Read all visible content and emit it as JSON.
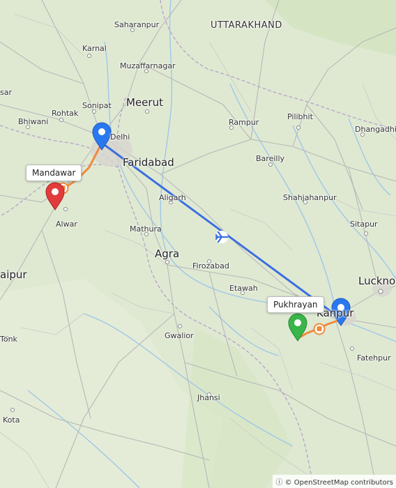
{
  "map": {
    "places": {
      "saharanpur": "Saharanpur",
      "uttarakhand": "UTTARAKHAND",
      "karnal": "Karnal",
      "muzaffarnagar": "Muzaffarnagar",
      "sar": "sar",
      "sonipat": "Sonipat",
      "meerut": "Meerut",
      "rohtak": "Rohtak",
      "rampur": "Rampur",
      "pilibhit": "Pilibhit",
      "dhangadhi": "Dhangadhi",
      "bhiwani": "Bhiwani",
      "delhi": "Delhi",
      "faridabad": "Faridabad",
      "bareilly": "Bareilly",
      "aligarh": "Aligarh",
      "shahjahanpur": "Shahjahanpur",
      "alwar": "Alwar",
      "mathura": "Mathura",
      "sitapur": "Sitapur",
      "agra": "Agra",
      "firozabad": "Firozabad",
      "jaipur": "aipur",
      "lucknow": "Luckno",
      "etawah": "Etawah",
      "kanpur": "Kanpur",
      "tonk": "Tonk",
      "gwalior": "Gwalior",
      "fatehpur": "Fatehpur",
      "jhansi": "Jhansi",
      "kota": "Kota"
    },
    "callouts": {
      "mandawar": "Mandawar",
      "pukhrayan": "Pukhrayan"
    },
    "attribution": "© OpenStreetMap contributors",
    "colors": {
      "flight_route": "#3b6ee0",
      "road_route": "#ee8a3b",
      "pin_blue": "#2a78f0",
      "pin_red": "#e23b3b",
      "pin_green": "#39b54a"
    },
    "icons": {
      "flight": "airplane-icon",
      "transfer": "bus-icon"
    }
  }
}
